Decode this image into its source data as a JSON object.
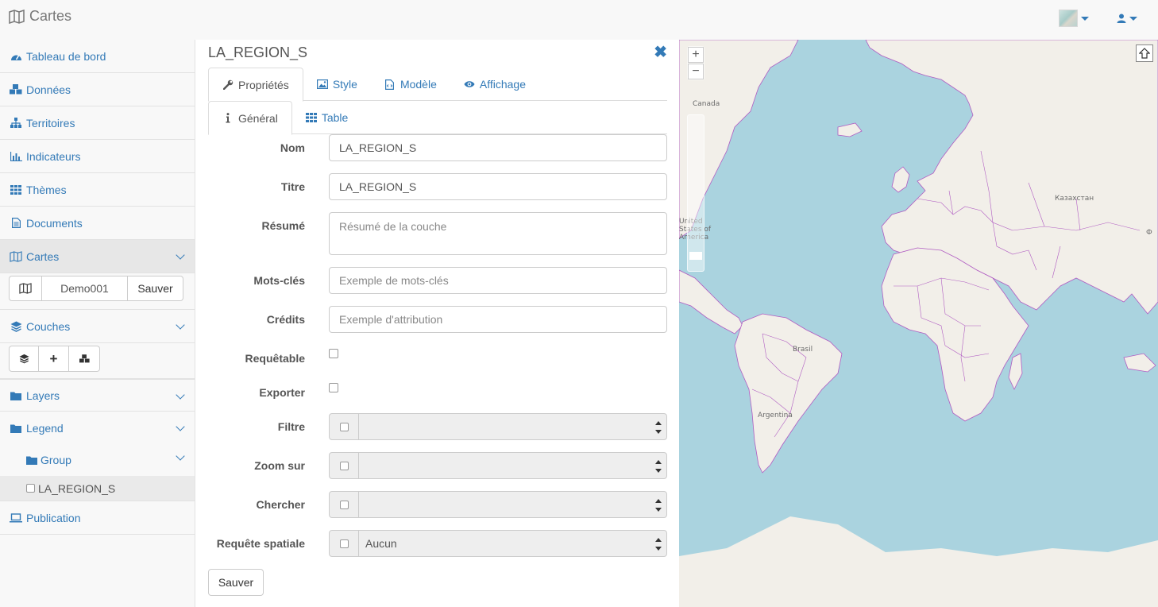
{
  "app": {
    "title": "Cartes"
  },
  "sidebar": {
    "items": [
      {
        "label": "Tableau de bord",
        "icon": "dashboard-icon"
      },
      {
        "label": "Données",
        "icon": "cubes-icon"
      },
      {
        "label": "Territoires",
        "icon": "sitemap-icon"
      },
      {
        "label": "Indicateurs",
        "icon": "bar-chart-icon"
      },
      {
        "label": "Thèmes",
        "icon": "grid-icon"
      },
      {
        "label": "Documents",
        "icon": "document-icon"
      },
      {
        "label": "Cartes",
        "icon": "map-icon"
      }
    ],
    "map_name": "Demo001",
    "save_label": "Sauver",
    "couches_label": "Couches",
    "layers_label": "Layers",
    "legend_label": "Legend",
    "group_label": "Group",
    "layer_item_label": "LA_REGION_S",
    "publication_label": "Publication"
  },
  "panel": {
    "title": "LA_REGION_S",
    "tabs": [
      {
        "label": "Propriétés",
        "icon": "wrench-icon"
      },
      {
        "label": "Style",
        "icon": "image-icon"
      },
      {
        "label": "Modèle",
        "icon": "file-code-icon"
      },
      {
        "label": "Affichage",
        "icon": "eye-icon"
      }
    ],
    "subtabs": [
      {
        "label": "Général",
        "icon": "info-icon"
      },
      {
        "label": "Table",
        "icon": "table-icon"
      }
    ],
    "fields": {
      "nom": {
        "label": "Nom",
        "value": "LA_REGION_S"
      },
      "titre": {
        "label": "Titre",
        "value": "LA_REGION_S"
      },
      "resume": {
        "label": "Résumé",
        "placeholder": "Résumé de la couche"
      },
      "mots_cles": {
        "label": "Mots-clés",
        "placeholder": "Exemple de mots-clés"
      },
      "credits": {
        "label": "Crédits",
        "placeholder": "Exemple d'attribution"
      },
      "requetable": {
        "label": "Requêtable"
      },
      "exporter": {
        "label": "Exporter"
      },
      "filtre": {
        "label": "Filtre",
        "value": ""
      },
      "zoom_sur": {
        "label": "Zoom sur",
        "value": ""
      },
      "chercher": {
        "label": "Chercher",
        "value": ""
      },
      "requete_spatiale": {
        "label": "Requête spatiale",
        "value": "Aucun"
      }
    },
    "save_label": "Sauver"
  },
  "map": {
    "zoom_in": "+",
    "zoom_out": "−",
    "labels": {
      "canada": "Canada",
      "usa": "United States of America",
      "brasil": "Brasil",
      "argentina": "Argentina",
      "kazakhstan": "Казахстан",
      "russia_partial": "Ф"
    },
    "colors": {
      "water": "#aad3df",
      "land": "#f2efe9",
      "border": "#b05cc2"
    }
  }
}
